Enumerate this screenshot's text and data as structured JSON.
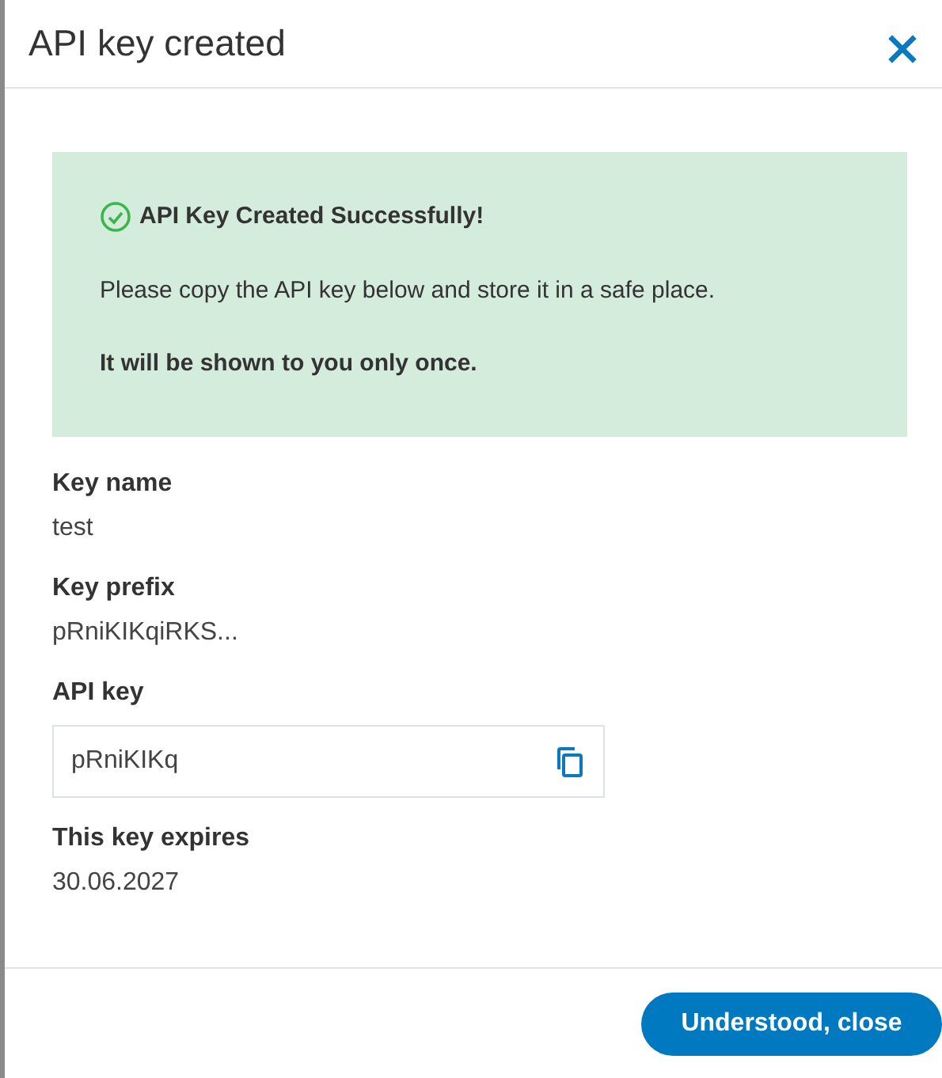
{
  "dialog": {
    "title": "API key created"
  },
  "alert": {
    "title": "API Key Created Successfully!",
    "message": "Please copy the API key below and store it in a safe place.",
    "warning": "It will be shown to you only once."
  },
  "fields": [
    {
      "kind": "text",
      "label": "Key name",
      "value": "test"
    },
    {
      "kind": "text",
      "label": "Key prefix",
      "value": "pRniKIKqiRKS..."
    },
    {
      "kind": "copy",
      "label": "API key",
      "value": "pRniKIKq"
    },
    {
      "kind": "text",
      "label": "This key expires",
      "value": "30.06.2027"
    }
  ],
  "buttons": [
    "Understood, close"
  ]
}
